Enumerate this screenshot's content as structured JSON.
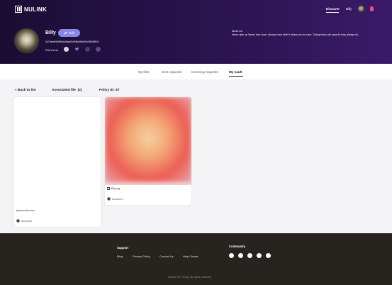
{
  "brand": {
    "name": "NULINK"
  },
  "topnav": {
    "discover": "Discover",
    "user": "Billy"
  },
  "profile": {
    "name": "Billy",
    "edit_label": "Edit",
    "address": "0x7aba94f4b54cd4acd1e39b0d5d20c38948f19",
    "find_me_label": "Find me on",
    "about_title": "About me",
    "about_text": "Never give up Never lose hope. Always have faith it allows you to cope. Trying times will pass As they always do."
  },
  "tabs": [
    {
      "label": "My files"
    },
    {
      "label": "Sent requests"
    },
    {
      "label": "Incoming requests"
    },
    {
      "label": "My vault",
      "active": true
    }
  ],
  "subhead": {
    "back": "« Back to list",
    "assoc_label": "Associated file",
    "assoc_count": "(2)",
    "policy": "Policy ID:  67"
  },
  "files": [
    {
      "name": "lyslauncher.exe",
      "owner": "account1",
      "thumb": "blank"
    },
    {
      "name": "8Rj.png",
      "owner": "account1",
      "thumb": "blurred-image"
    }
  ],
  "footer": {
    "support_title": "Support",
    "links": [
      "Blog",
      "Privacy Policy",
      "Contact Us",
      "Help Center"
    ],
    "community_title": "Community",
    "community_icons": [
      "telegram-icon",
      "discord-icon",
      "twitter-icon",
      "github-icon",
      "youtube-icon"
    ],
    "copyright": "©2021   NFT  Corp.  All rights reserved"
  },
  "colors": {
    "hero_dark": "#1a0d33",
    "hero_light": "#3b1a68",
    "accent": "#8a86e8",
    "footer": "#272420"
  }
}
